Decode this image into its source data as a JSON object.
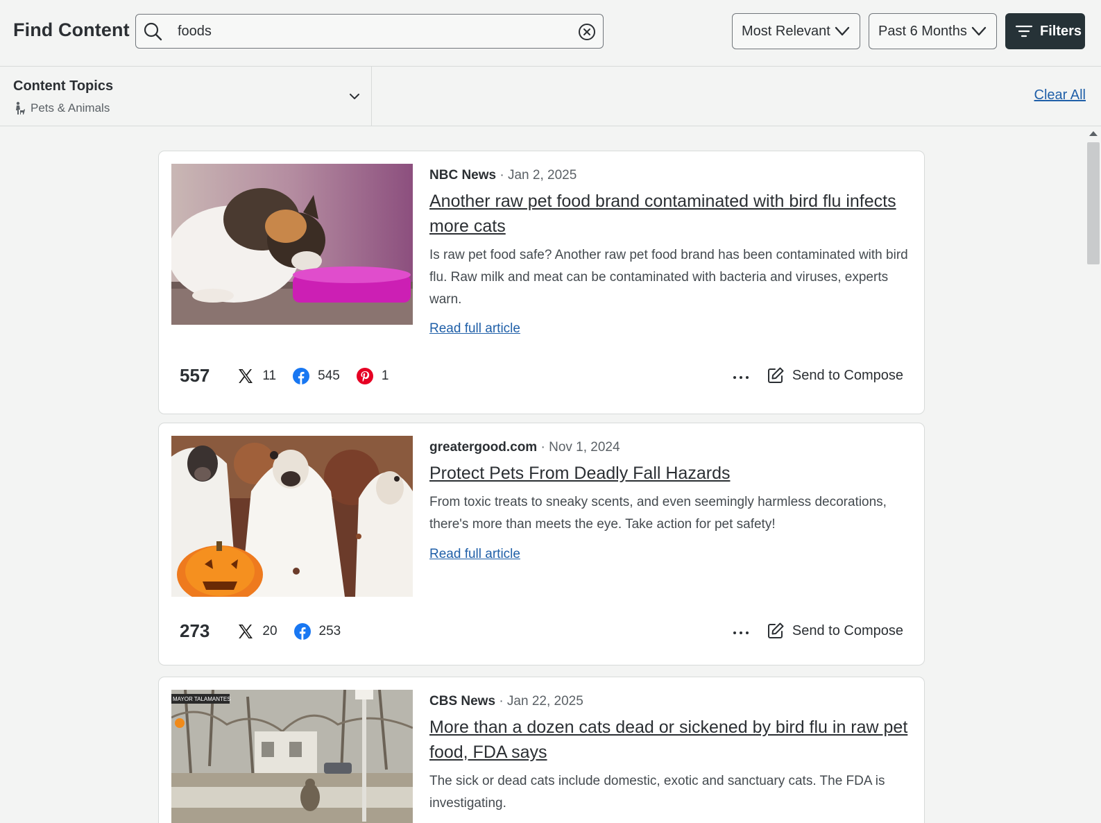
{
  "header": {
    "title": "Find Content",
    "search": {
      "value": "foods",
      "icon": "search-icon",
      "clear_icon": "clear-circle-icon"
    },
    "sort": {
      "selected": "Most Relevant"
    },
    "date_range": {
      "selected": "Past 6 Months"
    },
    "filters_label": "Filters"
  },
  "topics": {
    "label": "Content Topics",
    "selected": "Pets & Animals",
    "clear_all": "Clear All"
  },
  "colors": {
    "background": "#f3f4f3",
    "filters_button": "#263237",
    "link": "#1f5fa8",
    "facebook": "#1877f2",
    "pinterest": "#e60023"
  },
  "articles": [
    {
      "source": "NBC News",
      "date": "Jan 2, 2025",
      "title": "Another raw pet food brand contaminated with bird flu infects more cats",
      "description": "Is raw pet food safe? Another raw pet food brand has been contaminated with bird flu. Raw milk and meat can be contaminated with bacteria and viruses, experts warn.",
      "read_more": "Read full article",
      "total_shares": "557",
      "x_shares": "11",
      "facebook_shares": "545",
      "pinterest_shares": "1",
      "compose_label": "Send to Compose"
    },
    {
      "source": "greatergood.com",
      "date": "Nov 1, 2024",
      "title": "Protect Pets From Deadly Fall Hazards",
      "description": "From toxic treats to sneaky scents, and even seemingly harmless decorations, there's more than meets the eye. Take action for pet safety!",
      "read_more": "Read full article",
      "total_shares": "273",
      "x_shares": "20",
      "facebook_shares": "253",
      "compose_label": "Send to Compose"
    },
    {
      "source": "CBS News",
      "date": "Jan 22, 2025",
      "title": "More than a dozen cats dead or sickened by bird flu in raw pet food, FDA says",
      "description": "The sick or dead cats include domestic, exotic and sanctuary cats. The FDA is investigating.",
      "image_caption": "MAYOR TALAMANTES"
    }
  ]
}
